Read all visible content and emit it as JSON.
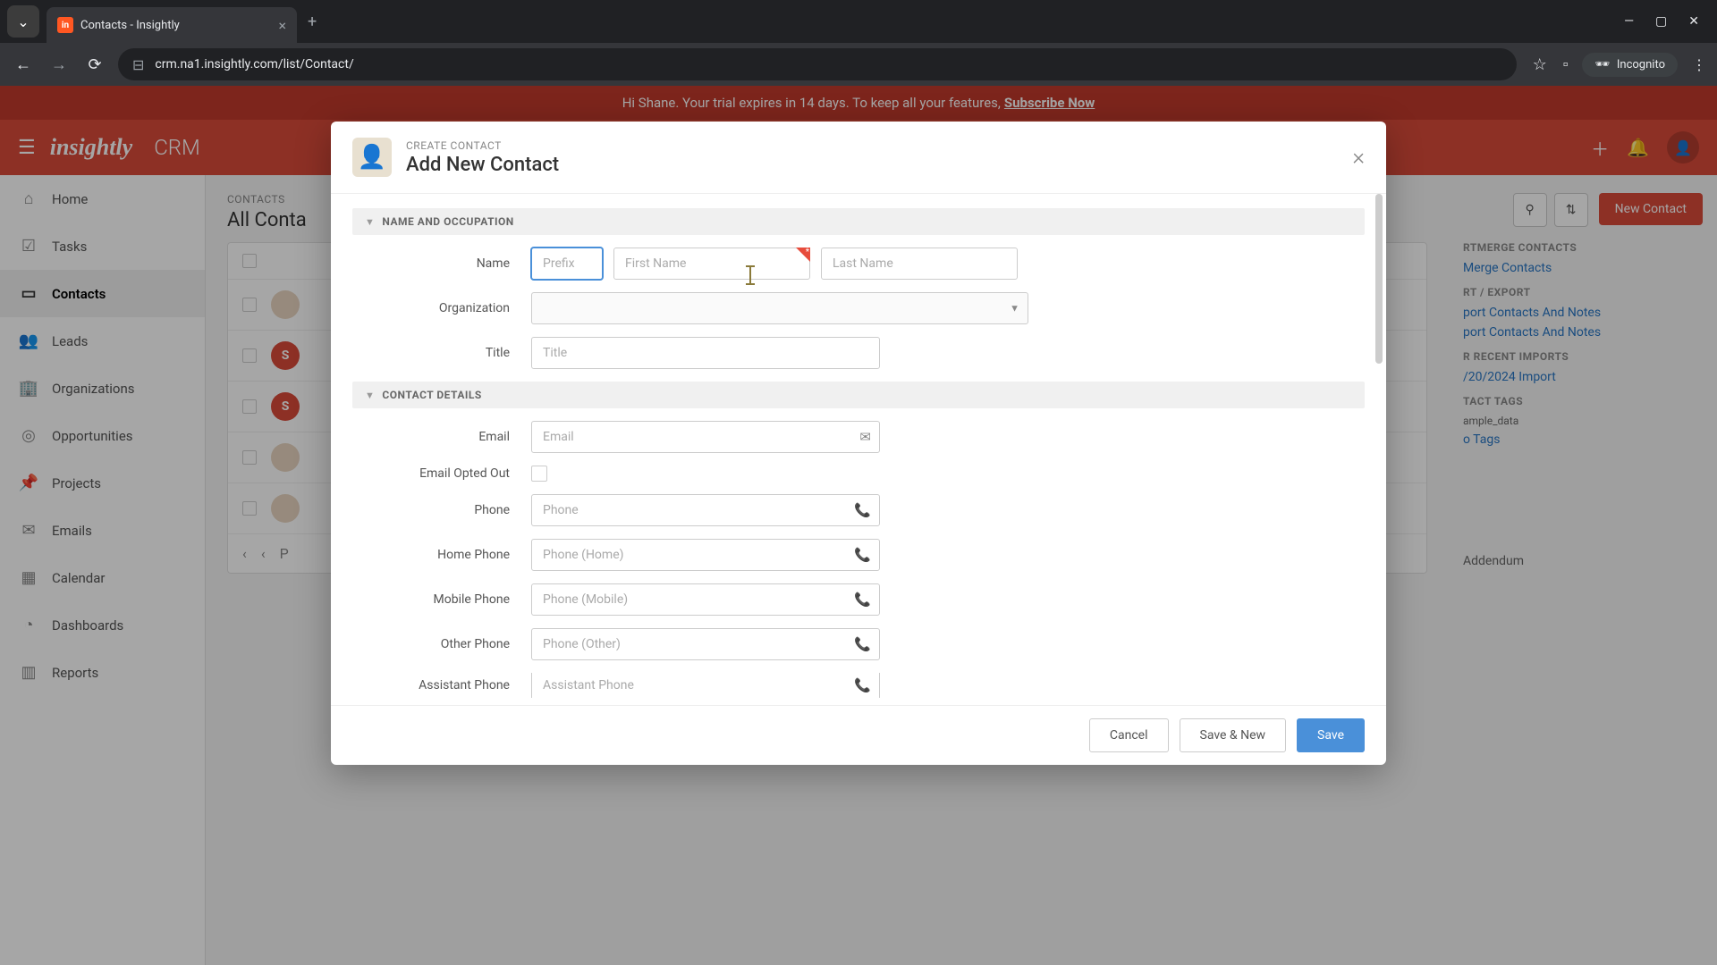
{
  "browser": {
    "tab_title": "Contacts - Insightly",
    "url": "crm.na1.insightly.com/list/Contact/",
    "incognito_label": "Incognito"
  },
  "banner": {
    "text": "Hi Shane. Your trial expires in 14 days. To keep all your features,",
    "link": "Subscribe Now"
  },
  "header": {
    "logo": "insightly",
    "product": "CRM"
  },
  "sidebar": {
    "items": [
      {
        "label": "Home",
        "icon": "⌂"
      },
      {
        "label": "Tasks",
        "icon": "☑"
      },
      {
        "label": "Contacts",
        "icon": "▭"
      },
      {
        "label": "Leads",
        "icon": "👥"
      },
      {
        "label": "Organizations",
        "icon": "🏢"
      },
      {
        "label": "Opportunities",
        "icon": "◎"
      },
      {
        "label": "Projects",
        "icon": "📌"
      },
      {
        "label": "Emails",
        "icon": "✉"
      },
      {
        "label": "Calendar",
        "icon": "▦"
      },
      {
        "label": "Dashboards",
        "icon": "◔"
      },
      {
        "label": "Reports",
        "icon": "▥"
      }
    ]
  },
  "content": {
    "breadcrumb": "CONTACTS",
    "title": "All Conta",
    "new_btn": "New Contact",
    "pagination_label": "P"
  },
  "right_panel": {
    "smartmerge_title": "RTMERGE CONTACTS",
    "smartmerge_link": "Merge Contacts",
    "import_title": "RT / EXPORT",
    "import_link": "port Contacts And Notes",
    "export_link": "port Contacts And Notes",
    "recent_title": "R RECENT IMPORTS",
    "recent_link": "/20/2024 Import",
    "tags_title": "TACT TAGS",
    "tag_sample": "ample_data",
    "tag_none": "o Tags",
    "addendum": "Addendum"
  },
  "modal": {
    "eyebrow": "CREATE CONTACT",
    "title": "Add New Contact",
    "sections": {
      "name": "NAME AND OCCUPATION",
      "contact": "CONTACT DETAILS"
    },
    "labels": {
      "name": "Name",
      "organization": "Organization",
      "title": "Title",
      "email": "Email",
      "email_opt": "Email Opted Out",
      "phone": "Phone",
      "home_phone": "Home Phone",
      "mobile_phone": "Mobile Phone",
      "other_phone": "Other Phone",
      "assistant_phone": "Assistant Phone"
    },
    "placeholders": {
      "prefix": "Prefix",
      "first_name": "First Name",
      "last_name": "Last Name",
      "title": "Title",
      "email": "Email",
      "phone": "Phone",
      "home_phone": "Phone (Home)",
      "mobile_phone": "Phone (Mobile)",
      "other_phone": "Phone (Other)",
      "assistant_phone": "Assistant Phone"
    },
    "buttons": {
      "cancel": "Cancel",
      "save_new": "Save & New",
      "save": "Save"
    }
  }
}
